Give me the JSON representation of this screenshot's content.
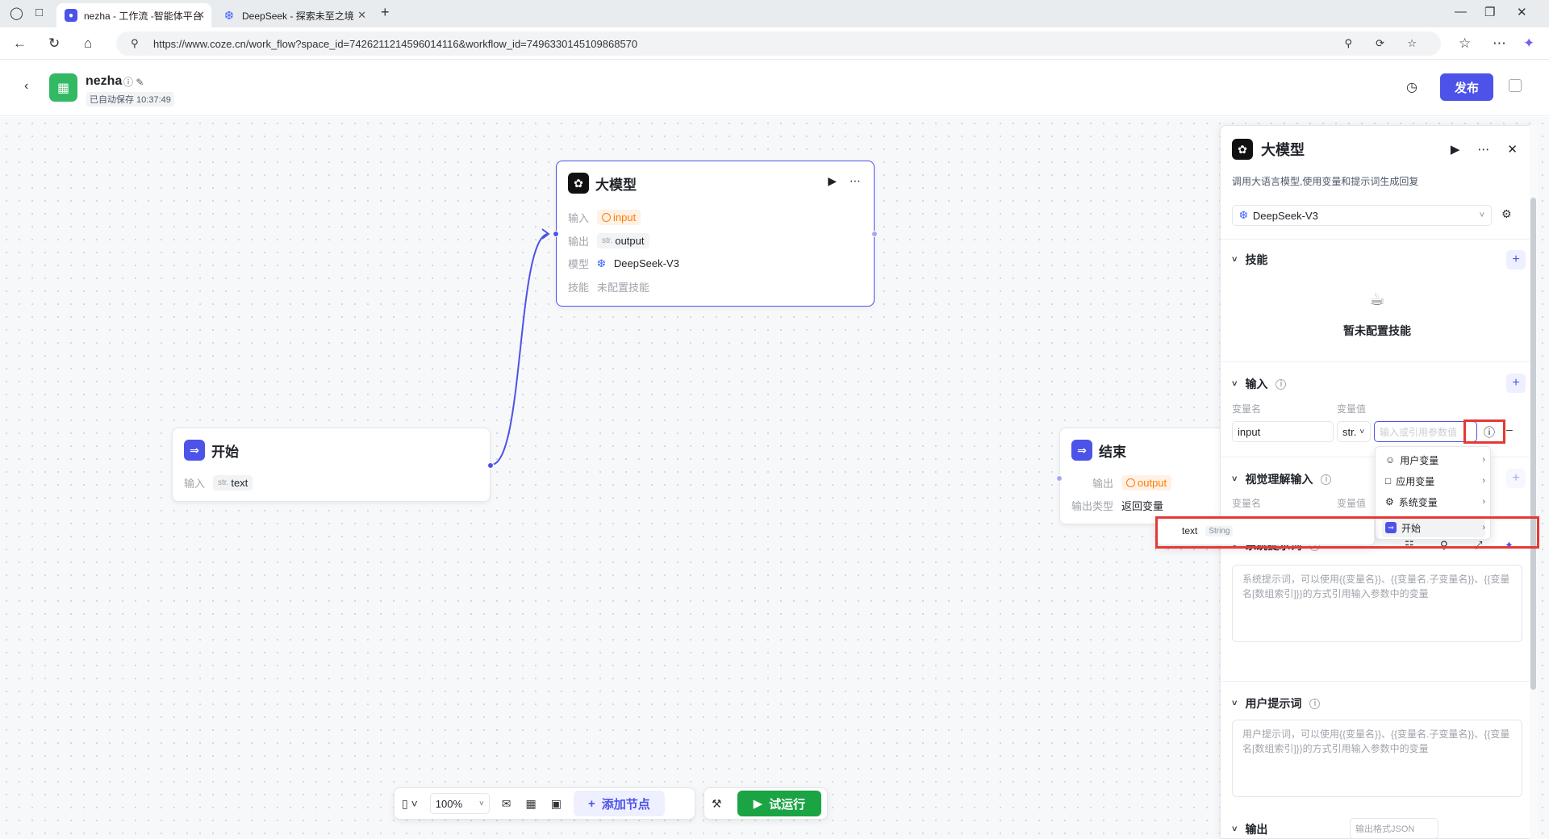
{
  "browser": {
    "tabs": [
      {
        "title": "nezha - 工作流 -智能体平台",
        "active": true
      },
      {
        "title": "DeepSeek - 探索未至之境",
        "active": false
      }
    ],
    "url": "https://www.coze.cn/work_flow?space_id=7426211214596014116&workflow_id=7496330145109868570"
  },
  "header": {
    "app_name": "nezha",
    "autosave": "已自动保存 10:37:49",
    "publish_label": "发布"
  },
  "nodes": {
    "llm": {
      "title": "大模型",
      "input_label": "输入",
      "input_value": "input",
      "output_label": "输出",
      "output_type": "str.",
      "output_value": "output",
      "model_label": "模型",
      "model_value": "DeepSeek-V3",
      "skill_label": "技能",
      "skill_value": "未配置技能"
    },
    "start": {
      "title": "开始",
      "input_label": "输入",
      "input_type": "str.",
      "input_value": "text"
    },
    "end": {
      "title": "结束",
      "output_label": "输出",
      "output_value": "output",
      "output_type_label": "输出类型",
      "output_type_value": "返回变量"
    }
  },
  "toolbar": {
    "zoom": "100%",
    "add_node_label": "添加节点",
    "run_label": "试运行"
  },
  "panel": {
    "title": "大模型",
    "description": "调用大语言模型,使用变量和提示词生成回复",
    "model": "DeepSeek-V3",
    "skills_title": "技能",
    "skills_empty": "暂未配置技能",
    "input_title": "输入",
    "var_name_label": "变量名",
    "var_value_label": "变量值",
    "input_name": "input",
    "input_type": "str.",
    "input_placeholder": "输入或引用参数值",
    "vision_title": "视觉理解输入",
    "sys_prompt_title": "系统提示词",
    "sys_prompt_placeholder": "系统提示词，可以使用{{变量名}}、{{变量名.子变量名}}、{{变量名[数组索引]}}的方式引用输入参数中的变量",
    "user_prompt_title": "用户提示词",
    "user_prompt_placeholder": "用户提示词，可以使用{{变量名}}、{{变量名.子变量名}}、{{变量名[数组索引]}}的方式引用输入参数中的变量",
    "output_title": "输出",
    "output_format": "输出格式JSON"
  },
  "dropdown": {
    "items": [
      "用户变量",
      "应用变量",
      "系统变量",
      "开始"
    ],
    "submenu_name": "text",
    "submenu_type": "String"
  },
  "colors": {
    "accent": "#4d53e8",
    "run": "#1aa443",
    "warn": "#ff7d00",
    "highlight": "#e53935"
  }
}
